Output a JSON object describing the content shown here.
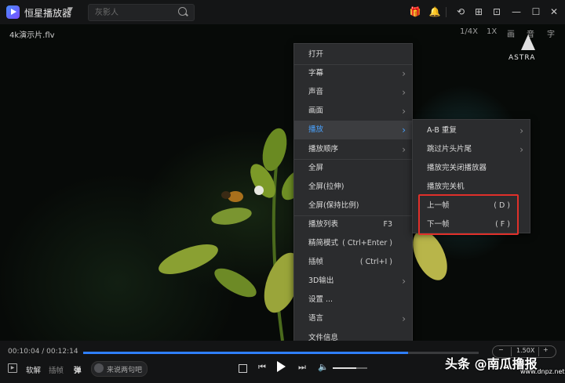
{
  "app": {
    "name": "恒星播放器",
    "search_placeholder": "灰影人",
    "filename": "4k演示片.flv"
  },
  "toolbar_right": {
    "zoom_quarter": "1/4X",
    "zoom_one": "1X",
    "picture": "画",
    "audio": "音",
    "subtitle": "字"
  },
  "watermark_logo": "ASTRA",
  "menu": [
    {
      "label": "打开",
      "shortcut": "",
      "submenu": false
    },
    {
      "label": "字幕",
      "shortcut": "",
      "submenu": true
    },
    {
      "label": "声音",
      "shortcut": "",
      "submenu": true
    },
    {
      "label": "画面",
      "shortcut": "",
      "submenu": true
    },
    {
      "label": "播放",
      "shortcut": "",
      "submenu": true,
      "active": true
    },
    {
      "label": "播放顺序",
      "shortcut": "",
      "submenu": true
    },
    {
      "label": "全屏",
      "shortcut": "",
      "submenu": false
    },
    {
      "label": "全屏(拉伸)",
      "shortcut": "",
      "submenu": false
    },
    {
      "label": "全屏(保持比例)",
      "shortcut": "",
      "submenu": false
    },
    {
      "label": "播放列表",
      "shortcut": "F3",
      "submenu": false
    },
    {
      "label": "精简模式",
      "shortcut": "( Ctrl+Enter )",
      "submenu": false
    },
    {
      "label": "插帧",
      "shortcut": "( Ctrl+I )",
      "submenu": false
    },
    {
      "label": "3D输出",
      "shortcut": "",
      "submenu": true
    },
    {
      "label": "设置 ...",
      "shortcut": "",
      "submenu": false
    },
    {
      "label": "语言",
      "shortcut": "",
      "submenu": true
    },
    {
      "label": "文件信息",
      "shortcut": "",
      "submenu": false
    }
  ],
  "submenu": [
    {
      "label": "A-B 重复",
      "shortcut": "",
      "submenu": true
    },
    {
      "label": "跳过片头片尾",
      "shortcut": "",
      "submenu": true
    },
    {
      "label": "播放完关闭播放器",
      "shortcut": "",
      "submenu": false
    },
    {
      "label": "播放完关机",
      "shortcut": "",
      "submenu": false
    },
    {
      "label": "上一帧",
      "shortcut": "( D )",
      "submenu": false
    },
    {
      "label": "下一帧",
      "shortcut": "( F )",
      "submenu": false
    }
  ],
  "playback": {
    "time_display": "00:10:04 / 00:12:14",
    "progress": 0.822,
    "speed": "1.50X",
    "speed_minus": "−",
    "speed_plus": "+",
    "soft_decode": "软解",
    "frame_interp": "插帧",
    "danmu": "弹",
    "danmu_placeholder": "来说两句吧",
    "volume": 0.68
  },
  "overlay_watermark": "头条 @南瓜撸报",
  "overlay_watermark_sub": "www.dnpz.net"
}
